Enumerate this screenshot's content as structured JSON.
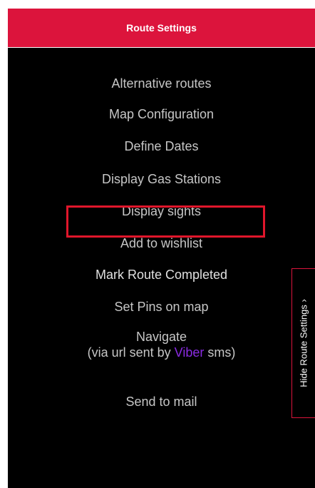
{
  "header": {
    "title": "Route Settings"
  },
  "menu": {
    "items": [
      {
        "label": "Alternative routes"
      },
      {
        "label": "Map Configuration"
      },
      {
        "label": "Define Dates"
      },
      {
        "label": "Display Gas Stations"
      },
      {
        "label": "Display sights"
      },
      {
        "label": "Add to wishlist"
      },
      {
        "label": "Mark Route Completed"
      },
      {
        "label": "Set Pins on map"
      }
    ],
    "navigate": {
      "label": "Navigate",
      "sub_prefix": "(via url sent by ",
      "sub_brand": "Viber",
      "sub_suffix": " sms)"
    },
    "send_mail": "Send to mail"
  },
  "side_tab": {
    "label": "Hide Route Settings ›"
  },
  "colors": {
    "header_bg": "#dc143c",
    "panel_bg": "#000000",
    "menu_text": "#c6c6c6",
    "highlight_border": "#e0162b",
    "viber": "#8a2be2"
  }
}
